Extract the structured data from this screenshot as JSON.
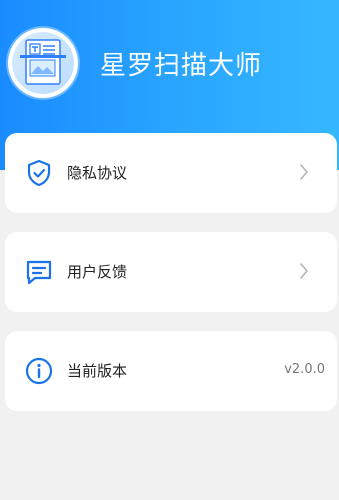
{
  "header": {
    "app_title": "星罗扫描大师",
    "logo_icon": "document-scan-logo-icon",
    "gradient_start": "#1a8cff",
    "gradient_end": "#35b8ff"
  },
  "menu": {
    "privacy": {
      "label": "隐私协议",
      "icon": "shield-check-icon"
    },
    "feedback": {
      "label": "用户反馈",
      "icon": "message-icon"
    },
    "version": {
      "label": "当前版本",
      "icon": "info-icon",
      "value": "v2.0.0"
    }
  },
  "colors": {
    "accent": "#1a73e8",
    "background": "#f1f1f1",
    "card": "#ffffff"
  }
}
